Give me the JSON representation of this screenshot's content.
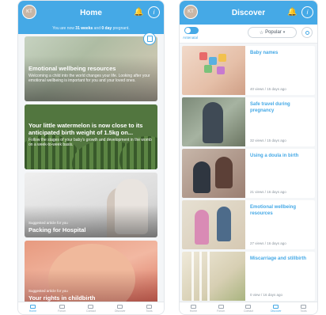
{
  "home": {
    "avatar_initials": "KT",
    "title": "Home",
    "banner_prefix": "You are now",
    "banner_weeks": "31 weeks",
    "banner_and": "and",
    "banner_days": "0 day",
    "banner_suffix": "pregnant.",
    "cards": [
      {
        "title": "Emotional wellbeing resources",
        "body": "Welcoming a child into the world changes your life. Looking after your emotional wellbeing is important for you and your loved ones."
      },
      {
        "title": "Your little watermelon is now close to its anticipated birth weight of 1.5kg on...",
        "body": "Follow the stages of your baby's growth and development in the womb on a week-to-week basis."
      },
      {
        "kicker": "Suggested article for you",
        "title": "Packing for Hospital"
      },
      {
        "kicker": "Suggested article for you",
        "title": "Your rights in childbirth"
      }
    ],
    "nav": [
      {
        "label": "Home",
        "active": true
      },
      {
        "label": "Forum",
        "active": false
      },
      {
        "label": "Contact",
        "active": false
      },
      {
        "label": "Discover",
        "active": false
      },
      {
        "label": "Tools",
        "active": false
      }
    ]
  },
  "discover": {
    "avatar_initials": "KT",
    "title": "Discover",
    "toggle_label": "Antenatal",
    "sort_label": "Popular",
    "articles": [
      {
        "title": "Baby names",
        "meta": "40 views / 15 days ago"
      },
      {
        "title": "Safe travel during pregnancy",
        "meta": "32 views / 15 days ago"
      },
      {
        "title": "Using a doula in birth",
        "meta": "21 views / 16 days ago"
      },
      {
        "title": "Emotional wellbeing resources",
        "meta": "27 views / 16 days ago"
      },
      {
        "title": "Miscarriage and stillbirth",
        "meta": "0 view / 16 days ago"
      }
    ],
    "nav": [
      {
        "label": "Home",
        "active": false
      },
      {
        "label": "Forum",
        "active": false
      },
      {
        "label": "Contact",
        "active": false
      },
      {
        "label": "Discover",
        "active": true
      },
      {
        "label": "Tools",
        "active": false
      }
    ]
  },
  "colors": {
    "accent": "#45a9e6",
    "background": "#f4f6f8",
    "muted_text": "#8a949d"
  },
  "icons": {
    "bell": "bell-icon",
    "info": "info-icon",
    "search": "search-icon",
    "star": "star-icon",
    "chevron": "chevron-down-icon",
    "fab": "document-icon"
  }
}
